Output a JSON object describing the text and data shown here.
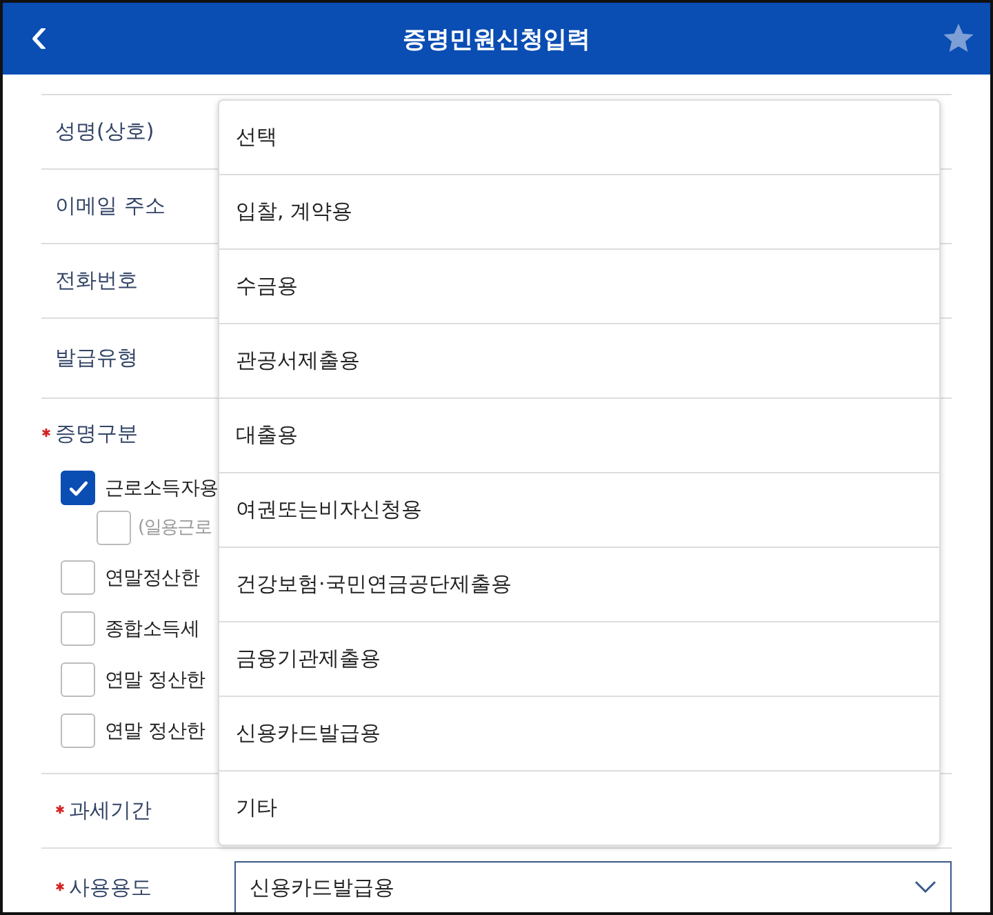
{
  "header": {
    "title": "증명민원신청입력",
    "back": "‹"
  },
  "fields": [
    {
      "label": "성명(상호)",
      "required": false
    },
    {
      "label": "이메일 주소",
      "required": false
    },
    {
      "label": "전화번호",
      "required": false
    },
    {
      "label": "발급유형",
      "required": false
    }
  ],
  "cert_type": {
    "label": "증명구분",
    "required": true,
    "options": [
      {
        "label": "근로소득자용",
        "checked": true,
        "children": [
          {
            "label": "(일용근로",
            "checked": false
          }
        ]
      },
      {
        "label": "연말정산한",
        "checked": false
      },
      {
        "label": "종합소득세",
        "checked": false
      },
      {
        "label": "연말 정산한",
        "checked": false
      },
      {
        "label": "연말 정산한",
        "checked": false
      }
    ]
  },
  "tax_period": {
    "label": "과세기간",
    "required": true
  },
  "usage": {
    "label": "사용용도",
    "required": true,
    "value": "신용카드발급용",
    "expanded": true,
    "options": [
      "선택",
      "입찰, 계약용",
      "수금용",
      "관공서제출용",
      "대출용",
      "여권또는비자신청용",
      "건강보험·국민연금공단제출용",
      "금융기관제출용",
      "신용카드발급용",
      "기타"
    ]
  }
}
